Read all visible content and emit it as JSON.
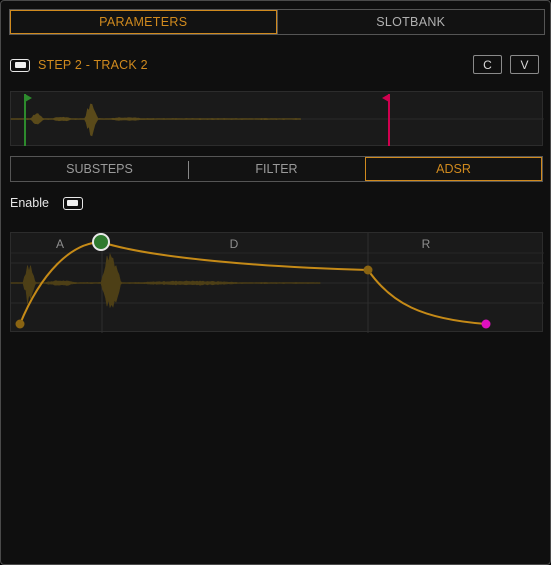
{
  "tabs": [
    {
      "label": "PARAMETERS",
      "active": true
    },
    {
      "label": "SLOTBANK",
      "active": false
    }
  ],
  "step": {
    "title": "STEP 2 - TRACK 2",
    "copy_label": "C",
    "paste_label": "V"
  },
  "subtabs": [
    {
      "label": "SUBSTEPS",
      "active": false
    },
    {
      "label": "FILTER",
      "active": false
    },
    {
      "label": "ADSR",
      "active": true
    }
  ],
  "enable": {
    "label": "Enable"
  },
  "envelope": {
    "segments": [
      "A",
      "D",
      "R"
    ]
  },
  "colors": {
    "accent": "#d08a1e",
    "curve": "#c58a17",
    "start_marker": "#2d8a2d",
    "end_marker": "#d0004f",
    "release_point": "#e010c0",
    "peak_point": "#2f7a2f",
    "waveform": "#5a4a1a"
  },
  "icons": {
    "start_marker": "flag-icon",
    "end_marker": "flag-icon"
  }
}
